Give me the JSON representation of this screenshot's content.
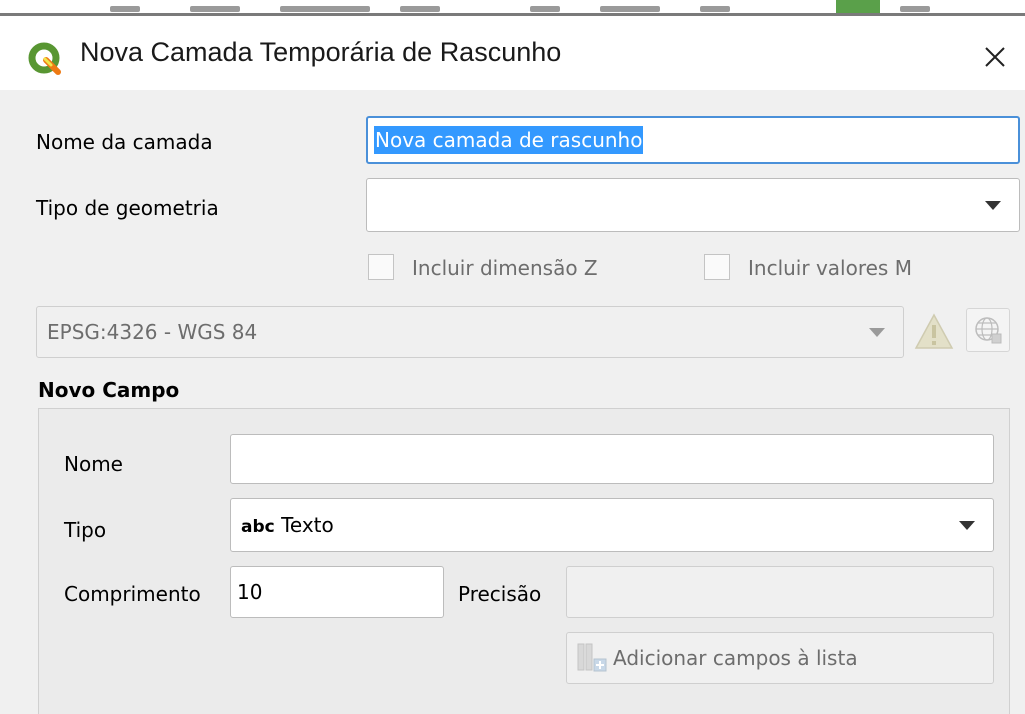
{
  "window": {
    "title": "Nova Camada Temporária de Rascunho",
    "close_label": "✕"
  },
  "form": {
    "layer_name_label": "Nome da camada",
    "layer_name_value": "Nova camada de rascunho",
    "geometry_type_label": "Tipo de geometria",
    "geometry_type_value": "",
    "include_z_label": "Incluir dimensão Z",
    "include_m_label": "Incluir valores M",
    "crs_value": "EPSG:4326 - WGS 84"
  },
  "new_field": {
    "group_title": "Novo Campo",
    "name_label": "Nome",
    "name_value": "",
    "type_label": "Tipo",
    "type_icon_text": "abc",
    "type_value": "Texto",
    "length_label": "Comprimento",
    "length_value": "10",
    "precision_label": "Precisão",
    "precision_value": "",
    "add_button_label": "Adicionar campos à lista"
  },
  "colors": {
    "accent_focus": "#4a90d9",
    "selection": "#3399ff",
    "qgis_green": "#589632",
    "qgis_yellow": "#ee7913"
  }
}
